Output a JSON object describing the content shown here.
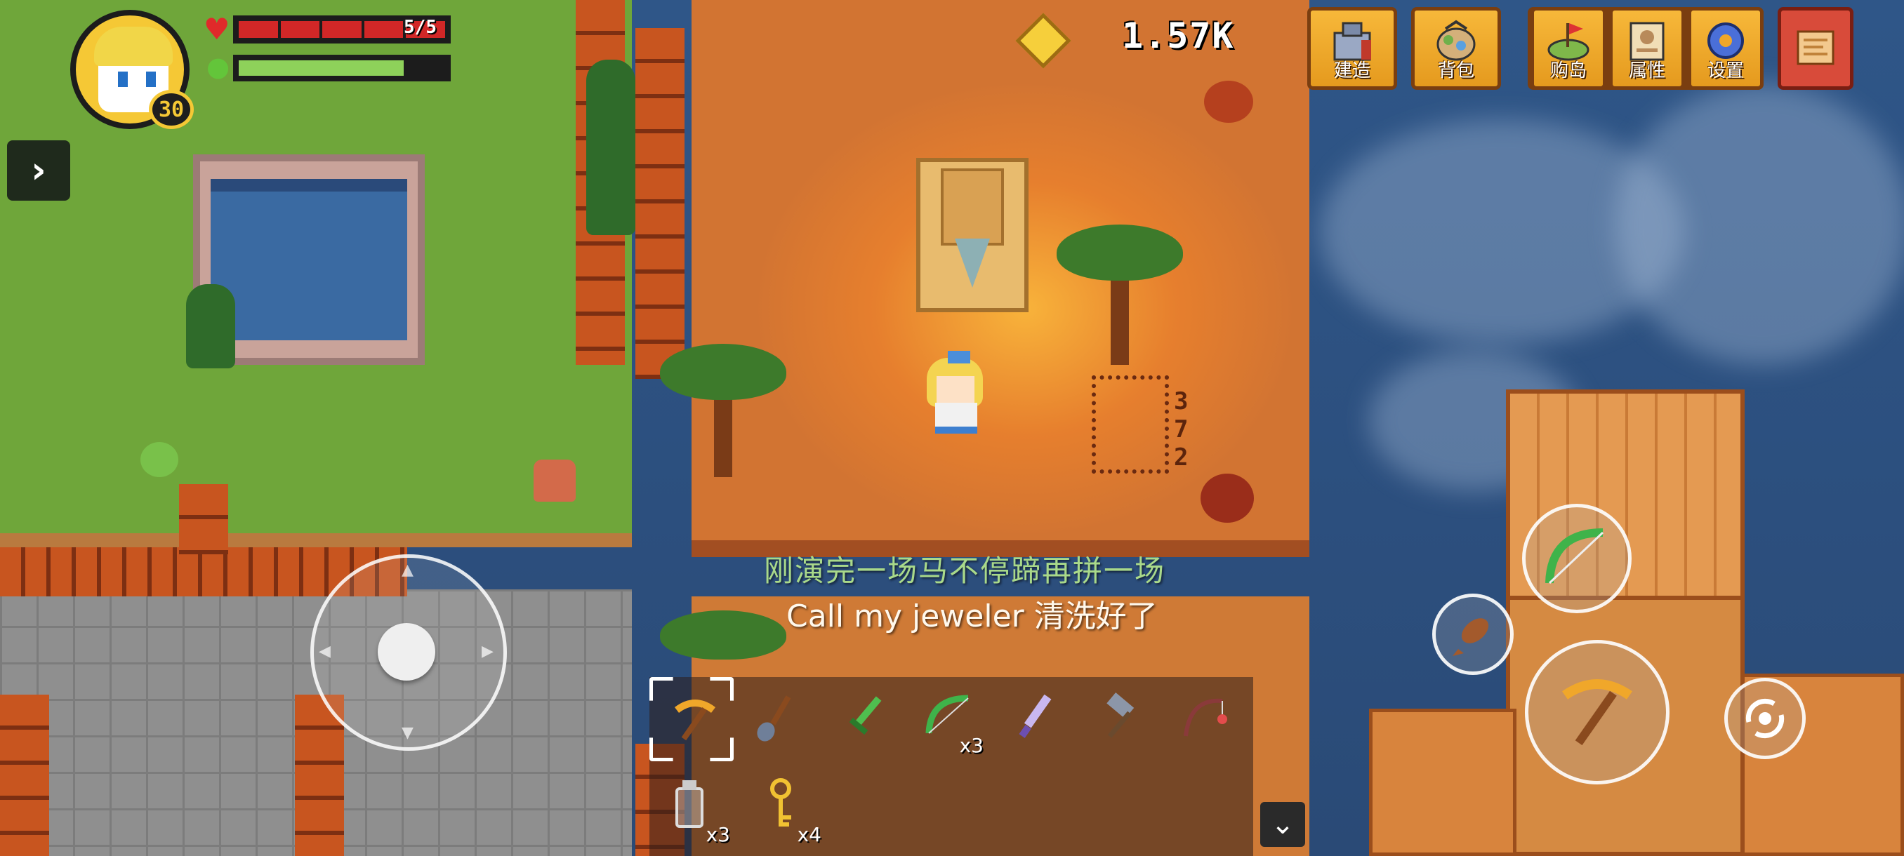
{
  "player": {
    "level": "30",
    "health_text": "5/5",
    "health_fraction": 1.0,
    "energy_fraction": 0.8
  },
  "currency": {
    "value": "1.57K",
    "icon": "gem-coin-icon"
  },
  "top_menu": [
    {
      "label": "建造",
      "icon": "build-icon"
    },
    {
      "label": "背包",
      "icon": "backpack-icon"
    },
    {
      "label": "购岛",
      "icon": "buy-island-icon"
    },
    {
      "label": "属性",
      "icon": "attributes-icon"
    },
    {
      "label": "设置",
      "icon": "settings-gear-icon"
    },
    {
      "label": "",
      "icon": "map-scroll-icon"
    }
  ],
  "subtitles": {
    "line1": "刚演完一场马不停蹄再拼一场",
    "line2": "Call my jeweler 清洗好了"
  },
  "hotbar": [
    {
      "icon": "pickaxe-icon",
      "count": "",
      "selected": true
    },
    {
      "icon": "shovel-icon",
      "count": ""
    },
    {
      "icon": "sword-icon",
      "count": ""
    },
    {
      "icon": "bow-icon",
      "count": "x3"
    },
    {
      "icon": "crystal-sword-icon",
      "count": ""
    },
    {
      "icon": "hammer-icon",
      "count": ""
    },
    {
      "icon": "fishing-rod-icon",
      "count": ""
    }
  ],
  "hotbar_second_row": [
    {
      "icon": "bottle-icon",
      "count": "x3"
    },
    {
      "icon": "key-icon",
      "count": "x4"
    }
  ],
  "dig_marks": [
    "3",
    "7",
    "2"
  ],
  "colors": {
    "accent": "#f5c835",
    "hp": "#d22727",
    "energy": "#8ed15a",
    "menu_orange": "#f0a72a",
    "map_red": "#d84b3a"
  }
}
